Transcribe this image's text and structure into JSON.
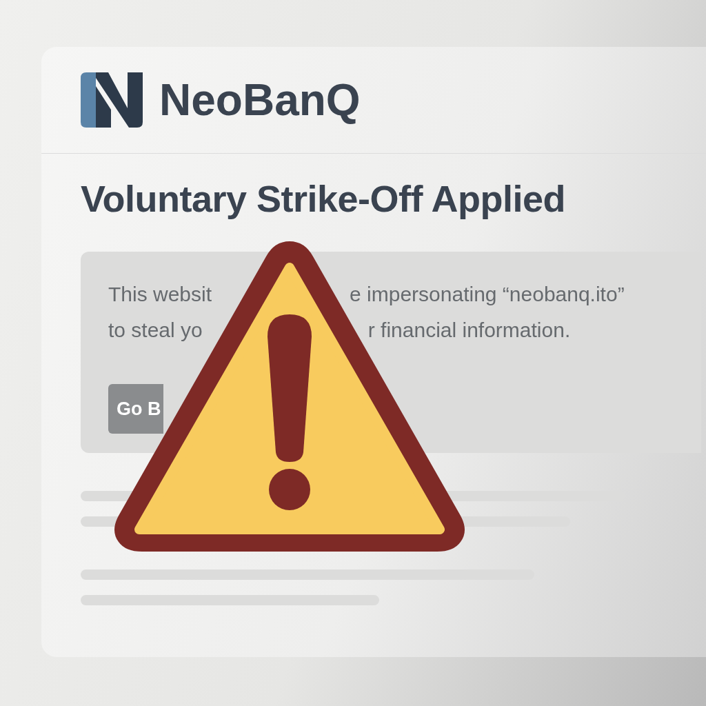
{
  "brand": {
    "name": "NeoBanQ"
  },
  "title": "Voluntary Strike-Off Applied",
  "notice": {
    "lines": [
      {
        "left": "This websit",
        "right": "e impersonating “neobanq.ito”"
      },
      {
        "left": "to steal yo",
        "right": "r financial information."
      }
    ],
    "button": "Go B"
  },
  "overlay": {
    "kind": "warning"
  }
}
